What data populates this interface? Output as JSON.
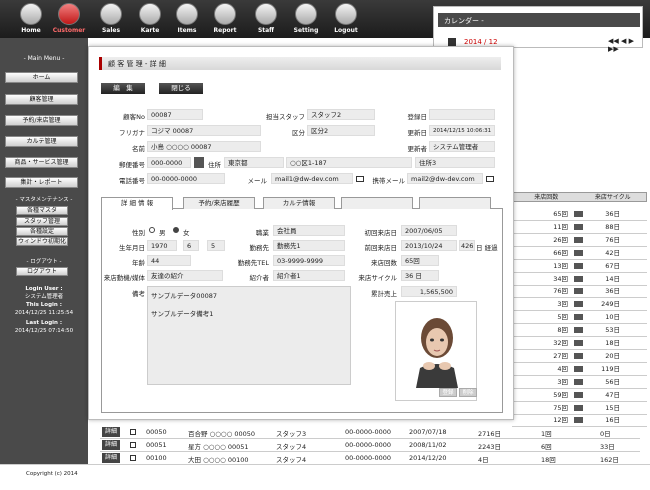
{
  "nav": [
    {
      "label": "Home",
      "active": false
    },
    {
      "label": "Customer",
      "active": true
    },
    {
      "label": "Sales",
      "active": false
    },
    {
      "label": "Karte",
      "active": false
    },
    {
      "label": "Items",
      "active": false
    },
    {
      "label": "Report",
      "active": false
    },
    {
      "label": "Staff",
      "active": false
    },
    {
      "label": "Setting",
      "active": false
    },
    {
      "label": "Logout",
      "active": false
    }
  ],
  "sidebar": {
    "main_menu": "- Main Menu -",
    "items": [
      "ホーム",
      "顧客管理",
      "予約/来店管理",
      "カルテ管理",
      "商品・サービス管理",
      "集計・レポート"
    ],
    "maint_head": "- マスタメンテナンス -",
    "maint_items": [
      "各種マスタ",
      "スタッフ管理",
      "各種設定",
      "ウィンドウ初期化"
    ],
    "logout_head": "- ログアウト -",
    "logout": "ログアウト",
    "login_user_label": "Login User :",
    "login_user": "システム管理者",
    "this_login_label": "This Login :",
    "this_login": "2014/12/25 11:25:54",
    "last_login_label": "Last Login :",
    "last_login": "2014/12/25 07:14:50"
  },
  "calendar": {
    "title": "カレンダー -",
    "month": "2014 / 12",
    "arrows": "◀◀ ◀ ▶ ▶▶"
  },
  "modal": {
    "title": "顧 客 管 理 - 詳 細",
    "edit": "編　集",
    "close": "閉じる",
    "fields": {
      "customer_no_label": "顧客No",
      "customer_no": "00087",
      "staff_label": "担当スタッフ",
      "staff": "スタッフ2",
      "reg_date_label": "登録日",
      "reg_date": "",
      "kana_label": "フリガナ",
      "kana": "コジマ 00087",
      "class_label": "区分",
      "class": "区分2",
      "upd_date_label": "更新日",
      "upd_date": "2014/12/15 10:06:31",
      "name_label": "名前",
      "name": "小島 ○○○○ 00087",
      "updater_label": "更新者",
      "updater": "システム管理者",
      "zip_label": "郵便番号",
      "zip": "000-0000",
      "address_label": "住所",
      "pref": "東京都",
      "address": "○○区1-187",
      "address2": "住所3",
      "phone_label": "電話番号",
      "phone": "00-0000-0000",
      "mail_label": "メール",
      "mail": "mail1@dw-dev.com",
      "mobile_mail_label": "携帯メール",
      "mobile_mail": "mail2@dw-dev.com"
    },
    "tabs": [
      "詳 細 情 報",
      "予約/来店履歴",
      "カルテ情報",
      "",
      ""
    ],
    "detail": {
      "gender_label": "性別",
      "male": "男",
      "female": "女",
      "job_label": "職業",
      "job": "会社員",
      "first_visit_label": "初回来店日",
      "first_visit": "2007/06/05",
      "birth_label": "生年月日",
      "birth_y": "1970",
      "birth_m": "6",
      "birth_d": "5",
      "work_label": "勤務先",
      "work": "勤務先1",
      "prev_visit_label": "前回来店日",
      "prev_visit": "2013/10/24",
      "elapsed": "426",
      "elapsed_unit": "日 経過",
      "age_label": "年齢",
      "age": "44",
      "work_tel_label": "勤務先TEL",
      "work_tel": "03-9999-9999",
      "visits_label": "来店回数",
      "visits": "65回",
      "motive_label": "来店動機/媒体",
      "motive": "友達の紹介",
      "referrer_label": "紹介者",
      "referrer": "紹介者1",
      "cycle_label": "来店サイクル",
      "cycle": "36 日",
      "sales_label": "累計売上",
      "sales": "1,565,500",
      "memo_label": "備考",
      "memo1": "サンプルデータ00087",
      "memo2": "サンプルデータ備考1",
      "btn_register": "登録",
      "btn_delete": "削除"
    }
  },
  "bg_table": {
    "headers": [
      "来店回数",
      "来店サイクル"
    ],
    "rows": [
      [
        "65回",
        "36日"
      ],
      [
        "11回",
        "88日"
      ],
      [
        "26回",
        "76日"
      ],
      [
        "66回",
        "42日"
      ],
      [
        "13回",
        "67日"
      ],
      [
        "34回",
        "14日"
      ],
      [
        "76回",
        "36日"
      ],
      [
        "3回",
        "249日"
      ],
      [
        "5回",
        "10日"
      ],
      [
        "8回",
        "53日"
      ],
      [
        "32回",
        "18日"
      ],
      [
        "27回",
        "20日"
      ],
      [
        "4回",
        "119日"
      ],
      [
        "3回",
        "56日"
      ],
      [
        "59回",
        "47日"
      ],
      [
        "75回",
        "15日"
      ],
      [
        "12回",
        "16日"
      ]
    ]
  },
  "bottom_rows": [
    {
      "detail": "詳細",
      "id": "00050",
      "name": "百合野 ○○○○ 00050",
      "staff": "スタッフ3",
      "phone": "00-0000-0000",
      "date": "2007/07/18",
      "days": "2716日",
      "visits": "1回",
      "cycle": "0日"
    },
    {
      "detail": "詳細",
      "id": "00051",
      "name": "星方 ○○○○ 00051",
      "staff": "スタッフ4",
      "phone": "00-0000-0000",
      "date": "2008/11/02",
      "days": "2243日",
      "visits": "6回",
      "cycle": "33日"
    },
    {
      "detail": "詳細",
      "id": "00100",
      "name": "大田 ○○○○ 00100",
      "staff": "スタッフ4",
      "phone": "00-0000-0000",
      "date": "2014/12/20",
      "days": "4日",
      "visits": "18回",
      "cycle": "162日"
    }
  ],
  "footer": "Copyright (c) 2014 "
}
